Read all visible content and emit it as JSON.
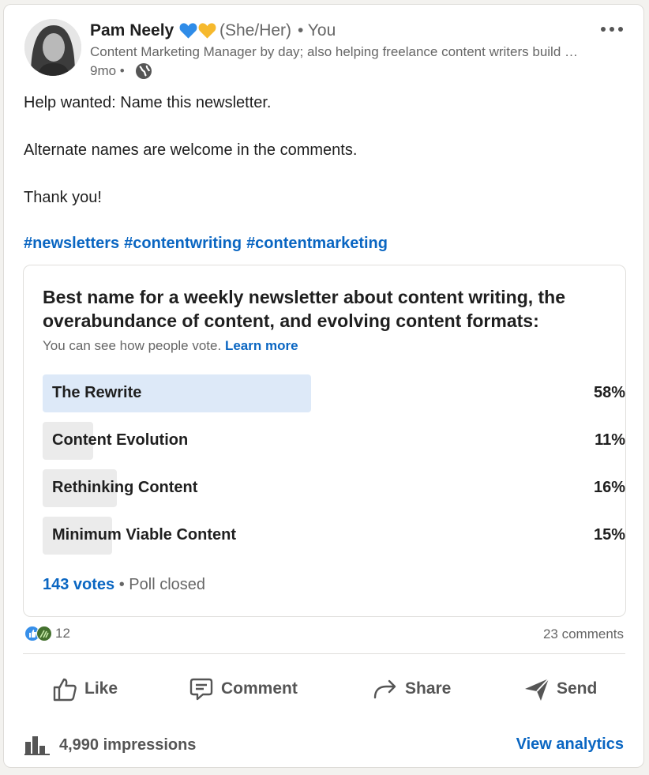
{
  "author": {
    "name": "Pam Neely",
    "pronouns": "(She/Her)",
    "relation": "• You",
    "headline": "Content Marketing Manager by day; also helping freelance content writers build their businesses",
    "time": "9mo •"
  },
  "post": {
    "line1": "Help wanted: Name this newsletter.",
    "line2": "Alternate names are welcome in the comments.",
    "line3": "Thank you!",
    "hashtags": [
      "#newsletters",
      "#contentwriting",
      "#contentmarketing"
    ]
  },
  "poll": {
    "question": "Best name for a weekly newsletter about content writing, the overabundance of content, and evolving content formats:",
    "note": "You can see how people vote.",
    "learn_more": "Learn more",
    "options": [
      {
        "label": "The Rewrite",
        "percent": "58%",
        "value": 0.58
      },
      {
        "label": "Content Evolution",
        "percent": "11%",
        "value": 0.11
      },
      {
        "label": "Rethinking Content",
        "percent": "16%",
        "value": 0.16
      },
      {
        "label": "Minimum Viable Content",
        "percent": "15%",
        "value": 0.15
      }
    ],
    "votes": "143 votes",
    "status": "• Poll closed"
  },
  "social": {
    "reactions_count": "12",
    "comments": "23 comments"
  },
  "actions": {
    "like": "Like",
    "comment": "Comment",
    "share": "Share",
    "send": "Send"
  },
  "footer": {
    "impressions": "4,990 impressions",
    "analytics": "View analytics"
  },
  "colors": {
    "link": "#0a66c2",
    "winning_bar": "#dde9f8",
    "bar": "#ebebeb"
  }
}
